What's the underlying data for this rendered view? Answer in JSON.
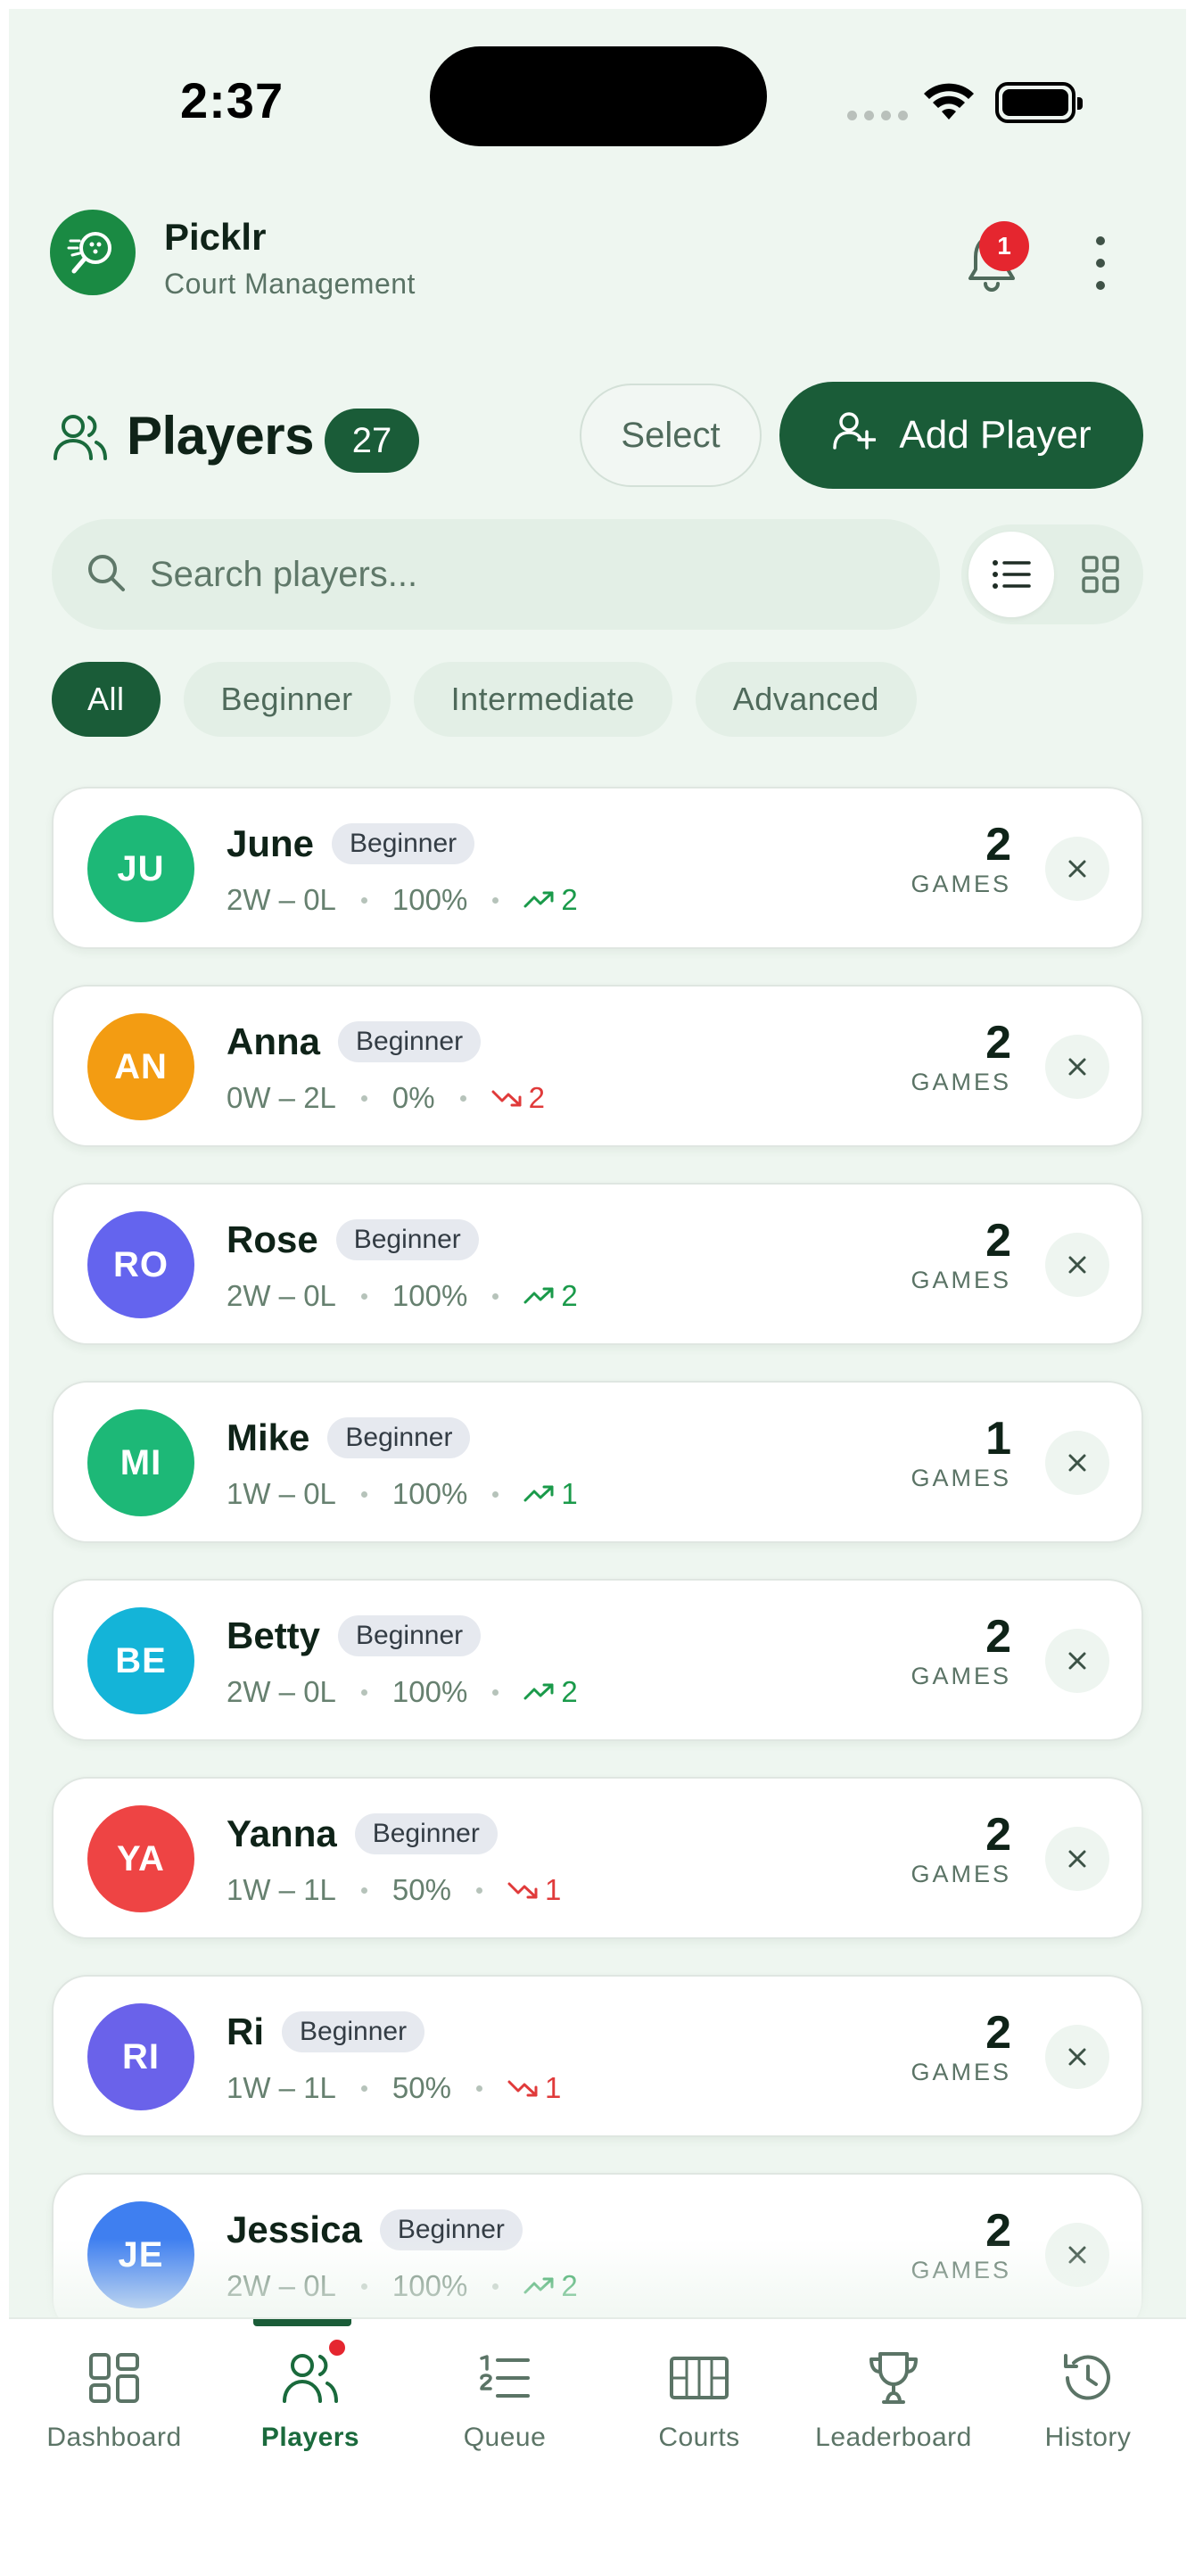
{
  "status_bar": {
    "time": "2:37"
  },
  "app": {
    "title": "Picklr",
    "subtitle": "Court Management",
    "notification_count": "1"
  },
  "players_header": {
    "title": "Players",
    "count": "27",
    "select_label": "Select",
    "add_label": "Add Player"
  },
  "search": {
    "placeholder": "Search players..."
  },
  "filters": [
    {
      "label": "All",
      "active": true
    },
    {
      "label": "Beginner",
      "active": false
    },
    {
      "label": "Intermediate",
      "active": false
    },
    {
      "label": "Advanced",
      "active": false
    }
  ],
  "games_label": "GAMES",
  "players": [
    {
      "initials": "JU",
      "name": "June",
      "level": "Beginner",
      "record": "2W – 0L",
      "win_pct": "100%",
      "trend": "up",
      "trend_value": "2",
      "games": "2",
      "color": "#1db877"
    },
    {
      "initials": "AN",
      "name": "Anna",
      "level": "Beginner",
      "record": "0W – 2L",
      "win_pct": "0%",
      "trend": "down",
      "trend_value": "2",
      "games": "2",
      "color": "#f39c12"
    },
    {
      "initials": "RO",
      "name": "Rose",
      "level": "Beginner",
      "record": "2W – 0L",
      "win_pct": "100%",
      "trend": "up",
      "trend_value": "2",
      "games": "2",
      "color": "#6464ee"
    },
    {
      "initials": "MI",
      "name": "Mike",
      "level": "Beginner",
      "record": "1W – 0L",
      "win_pct": "100%",
      "trend": "up",
      "trend_value": "1",
      "games": "1",
      "color": "#1db877"
    },
    {
      "initials": "BE",
      "name": "Betty",
      "level": "Beginner",
      "record": "2W – 0L",
      "win_pct": "100%",
      "trend": "up",
      "trend_value": "2",
      "games": "2",
      "color": "#14b4d8"
    },
    {
      "initials": "YA",
      "name": "Yanna",
      "level": "Beginner",
      "record": "1W – 1L",
      "win_pct": "50%",
      "trend": "down",
      "trend_value": "1",
      "games": "2",
      "color": "#ee4444"
    },
    {
      "initials": "RI",
      "name": "Ri",
      "level": "Beginner",
      "record": "1W – 1L",
      "win_pct": "50%",
      "trend": "down",
      "trend_value": "1",
      "games": "2",
      "color": "#6a62ea"
    },
    {
      "initials": "JE",
      "name": "Jessica",
      "level": "Beginner",
      "record": "2W – 0L",
      "win_pct": "100%",
      "trend": "up",
      "trend_value": "2",
      "games": "2",
      "color": "#3f7ff0"
    }
  ],
  "nav": [
    {
      "label": "Dashboard",
      "icon": "dashboard-icon",
      "active": false
    },
    {
      "label": "Players",
      "icon": "users-icon",
      "active": true
    },
    {
      "label": "Queue",
      "icon": "list-ordered-icon",
      "active": false
    },
    {
      "label": "Courts",
      "icon": "court-icon",
      "active": false
    },
    {
      "label": "Leaderboard",
      "icon": "trophy-icon",
      "active": false
    },
    {
      "label": "History",
      "icon": "history-icon",
      "active": false
    }
  ],
  "colors": {
    "primary": "#1a5c38",
    "background": "#eef6f0",
    "badge_red": "#e5262f",
    "trend_up": "#1a9a4a",
    "trend_down": "#e03a3a"
  }
}
